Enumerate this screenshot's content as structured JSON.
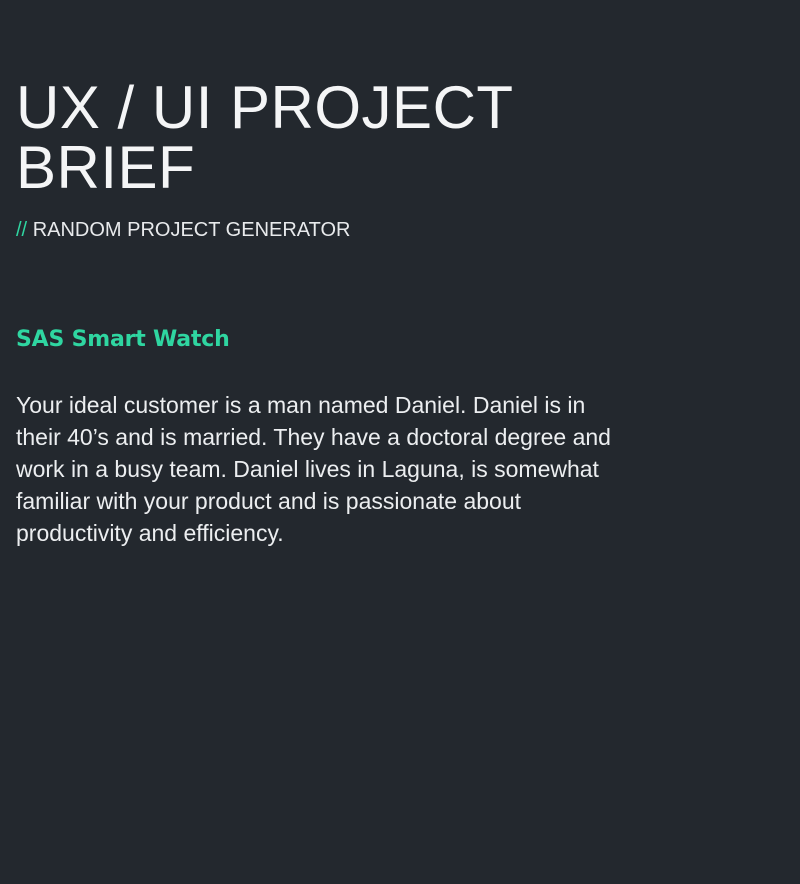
{
  "header": {
    "title": "UX / UI PROJECT BRIEF",
    "subtitle_prefix": "//",
    "subtitle": "RANDOM PROJECT GENERATOR"
  },
  "project": {
    "name": "SAS Smart Watch",
    "description": "Your ideal customer is a man named Daniel. Daniel is in their 40’s and is married. They have a doctoral degree and work in a busy team. Daniel lives in Laguna, is somewhat familiar with your product and is passionate about productivity and efficiency."
  },
  "colors": {
    "background": "#23282e",
    "accent": "#2fd6a1",
    "text": "#f2f3f4"
  }
}
